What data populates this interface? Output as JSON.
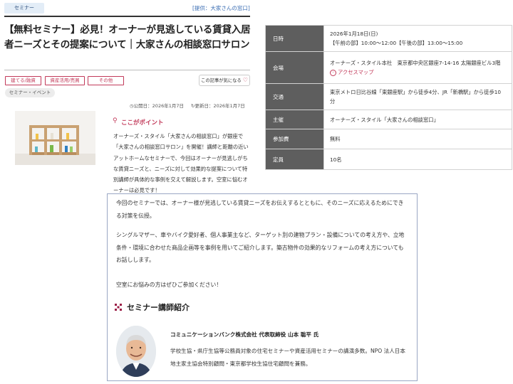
{
  "header": {
    "category_tag": "セミナー",
    "provider": "[提供：大家さんの窓口]"
  },
  "article": {
    "title": "【無料セミナー】必見！オーナーが見逃している賃貸入居者ニーズとその提案について｜大家さんの相談窓口サロン",
    "categories": [
      "建てる/融資",
      "資産活用/売買",
      "その他"
    ],
    "event_tag": "セミナー・イベント",
    "like_button": "この記事が気になる",
    "published": "公開日：2026年1月7日",
    "updated": "更新日：2026年1月7日",
    "point_heading": "ここがポイント",
    "summary": "オーナーズ・スタイル「大家さんの相談窓口」が銀座で「大家さんの相談窓口サロン」を開催！講師と距離の近いアットホームなセミナーで、今回はオーナーが見逃しがちな賃貸ニーズと、ニーズに対して効果的な提案について特別講師が具体的な事例を交えて解説します。空室に悩むオーナーは必見です！"
  },
  "details": {
    "date_label": "日時",
    "date_line1": "2026年1月18日(日)",
    "date_line2": "【午前の部】10:00〜12:00【午後の部】13:00〜15:00",
    "venue_label": "会場",
    "venue": "オーナーズ・スタイル本社　東京都中央区銀座7-14-16 太陽銀座ビル3階",
    "map_link": "アクセスマップ",
    "access_label": "交通",
    "access": "東京メトロ日比谷線「東銀座駅」から徒歩4分、JR「新橋駅」から徒歩10分",
    "host_label": "主催",
    "host": "オーナーズ・スタイル「大家さんの相談窓口」",
    "fee_label": "参加費",
    "fee": "無料",
    "capacity_label": "定員",
    "capacity": "10名"
  },
  "body": {
    "para1": "今回のセミナーでは、オーナー様が見逃している賃貸ニーズをお伝えするとともに、そのニーズに応えるためにできる対策を伝授。",
    "para2": "シングルマザー、車やバイク愛好者、個人事業主など、ターゲット別の建物プラン・設備についての考え方や、立地条件・環境に合わせた商品企画等を事例を用いてご紹介します。築古物件の効果的なリフォームの考え方についてもお話しします。",
    "para3": "空室にお悩みの方はぜひご参加ください！",
    "lecturer_heading": "セミナー講師紹介",
    "lecturer_name": "コミュニケーションバンク株式会社 代表取締役 山本 聡平 氏",
    "lecturer_bio": "学校生協・県庁生協等公務員対象の住宅セミナーや資産活用セミナーの講演多数。NPO 法人日本地主家主協会特別顧問・東京都学校生協住宅顧問を兼務。"
  },
  "icons": {
    "pin": "map-pin-icon",
    "heart": "heart-icon",
    "map_arrow": "arrow-circle-icon",
    "lecturer": "checker-square-icon"
  },
  "colors": {
    "accent": "#c23a5a",
    "table_label_bg": "#5e5e5e",
    "tag_bg": "#e3edf7",
    "link_blue": "#3a6db3",
    "box_border": "#9aa7c4"
  }
}
